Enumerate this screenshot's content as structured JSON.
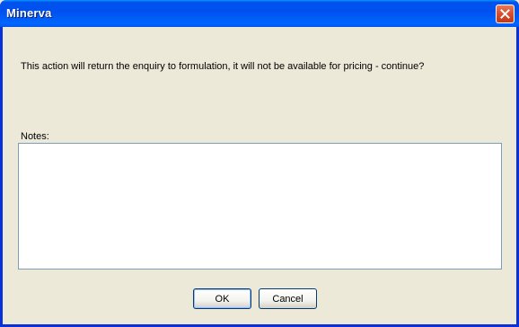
{
  "window": {
    "title": "Minerva",
    "close_icon": "close-icon"
  },
  "dialog": {
    "message": "This action will return the enquiry to formulation, it will not be available for pricing - continue?",
    "notes_label": "Notes:",
    "notes_value": "",
    "ok_label": "OK",
    "cancel_label": "Cancel"
  },
  "colors": {
    "titlebar": "#0055ea",
    "frame": "#0831d9",
    "background": "#ece9d8",
    "close_button": "#d94d2c",
    "input_border": "#7f9db9",
    "button_border": "#003c74"
  }
}
